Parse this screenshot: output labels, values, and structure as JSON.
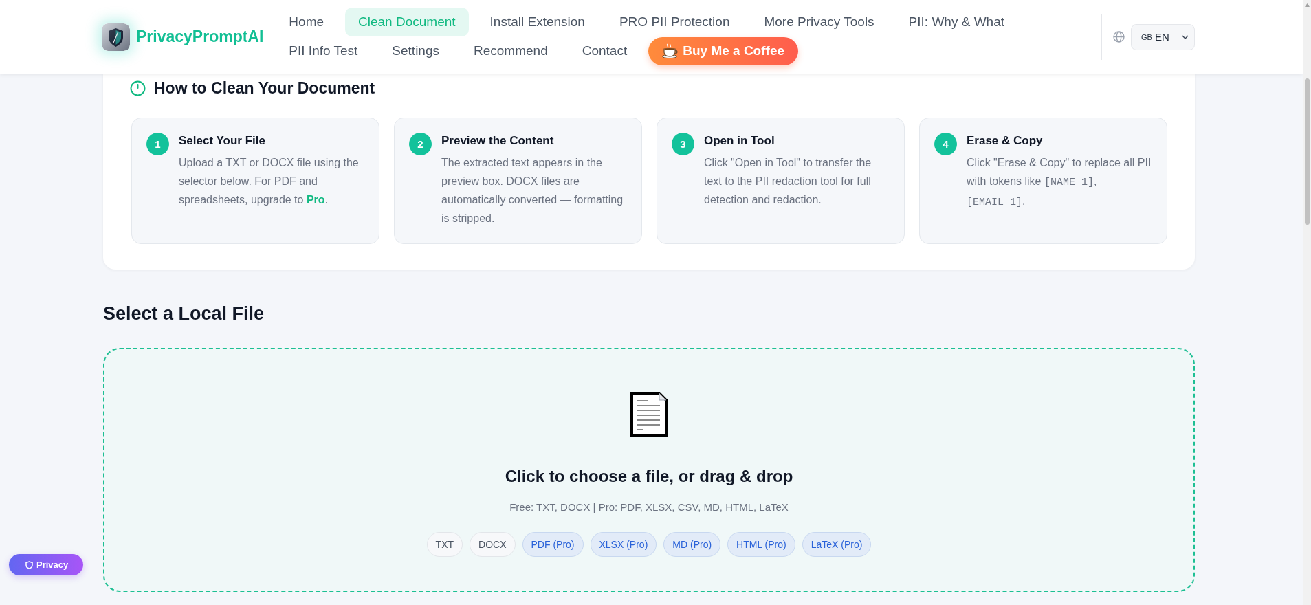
{
  "header": {
    "logo": {
      "text": "PrivacyPromptAI"
    },
    "nav": [
      {
        "label": "Home",
        "selected": false
      },
      {
        "label": "Clean Document",
        "selected": true
      },
      {
        "label": "Install Extension",
        "selected": false
      },
      {
        "label": "PRO PII Protection",
        "selected": false
      },
      {
        "label": "More Privacy Tools",
        "selected": false
      },
      {
        "label": "PII: Why & What",
        "selected": false
      },
      {
        "label": "PII Info Test",
        "selected": false
      },
      {
        "label": "Settings",
        "selected": false
      },
      {
        "label": "Recommend",
        "selected": false
      },
      {
        "label": "Contact",
        "selected": false
      }
    ],
    "coffee_button": {
      "label": "Buy Me a Coffee"
    },
    "language_select": {
      "flag": "GB",
      "value": "EN"
    }
  },
  "instructions": {
    "title": "How to Clean Your Document",
    "steps": [
      {
        "number": "1",
        "title": "Select Your File",
        "description": [
          {
            "kind": "text",
            "text": "Upload a TXT or DOCX file using the selector below. For PDF and spreadsheets, upgrade to "
          },
          {
            "kind": "link",
            "text": "Pro"
          },
          {
            "kind": "text",
            "text": "."
          }
        ]
      },
      {
        "number": "2",
        "title": "Preview the Content",
        "description": [
          {
            "kind": "text",
            "text": "The extracted text appears in the preview box. DOCX files are automatically converted — formatting is stripped."
          }
        ]
      },
      {
        "number": "3",
        "title": "Open in Tool",
        "description": [
          {
            "kind": "text",
            "text": "Click \"Open in Tool\" to transfer the text to the PII redaction tool for full detection and redaction."
          }
        ]
      },
      {
        "number": "4",
        "title": "Erase & Copy",
        "description": [
          {
            "kind": "text",
            "text": "Click \"Erase & Copy\" to replace all PII with tokens like "
          },
          {
            "kind": "code",
            "text": "[NAME_1]"
          },
          {
            "kind": "text",
            "text": ", "
          },
          {
            "kind": "code",
            "text": "[EMAIL_1]"
          },
          {
            "kind": "text",
            "text": "."
          }
        ]
      }
    ]
  },
  "file_section": {
    "title": "Select a Local File",
    "dropzone": {
      "prompt": "Click to choose a file, or drag & drop",
      "note": "Free: TXT, DOCX | Pro: PDF, XLSX, CSV, MD, HTML, LaTeX",
      "formats": [
        {
          "label": "TXT",
          "kind": "free"
        },
        {
          "label": "DOCX",
          "kind": "free"
        },
        {
          "label": "PDF (Pro)",
          "kind": "pro"
        },
        {
          "label": "XLSX (Pro)",
          "kind": "pro"
        },
        {
          "label": "MD (Pro)",
          "kind": "pro"
        },
        {
          "label": "HTML (Pro)",
          "kind": "pro"
        },
        {
          "label": "LaTeX (Pro)",
          "kind": "pro"
        }
      ]
    }
  },
  "privacy_button": {
    "label": "Privacy"
  }
}
